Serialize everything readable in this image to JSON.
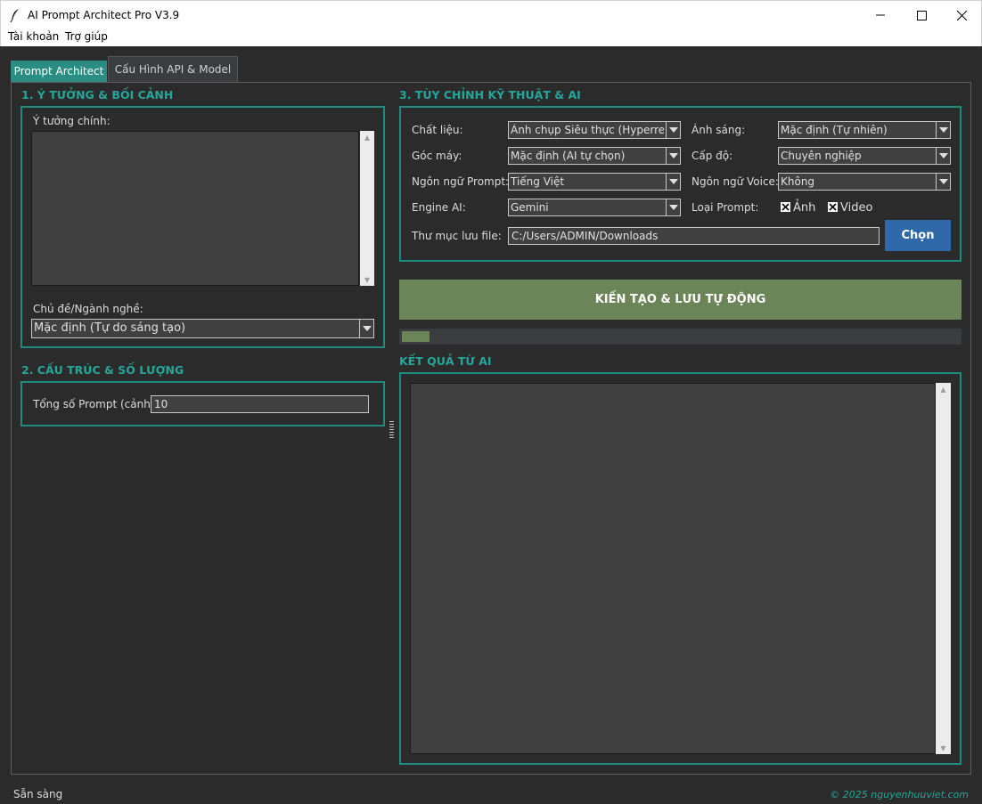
{
  "window": {
    "title": "AI Prompt Architect Pro V3.9",
    "controls": {
      "minimize": "minimize-icon",
      "maximize": "maximize-icon",
      "close": "close-icon"
    }
  },
  "menubar": {
    "items": [
      "Tài khoản",
      "Trợ giúp"
    ]
  },
  "tabs": [
    {
      "label": "Prompt Architect",
      "active": true
    },
    {
      "label": "Cấu Hình API & Model",
      "active": false
    }
  ],
  "section1": {
    "title": "1. Ý TƯỞNG & BỐI CẢNH",
    "idea_label": "Ý tưởng chính:",
    "idea_value": "",
    "topic_label": "Chủ đề/Ngành nghề:",
    "topic_value": "Mặc định (Tự do sáng tạo)"
  },
  "section2": {
    "title": "2. CẤU TRÚC & SỐ LƯỢNG",
    "total_label": "Tổng số Prompt (cảnh):",
    "total_value": "10"
  },
  "section3": {
    "title": "3. TÙY CHỈNH KỸ THUẬT & AI",
    "material_label": "Chất liệu:",
    "material_value": "Ảnh chụp Siêu thực (Hyperrealistic)",
    "lighting_label": "Ánh sáng:",
    "lighting_value": "Mặc định (Tự nhiên)",
    "camera_label": "Góc máy:",
    "camera_value": "Mặc định (AI tự chọn)",
    "level_label": "Cấp độ:",
    "level_value": "Chuyên nghiệp",
    "language_label": "Ngôn ngữ Prompt:",
    "language_value": "Tiếng Việt",
    "voice_label": "Ngôn ngữ Voice:",
    "voice_value": "Không",
    "engine_label": "Engine AI:",
    "engine_value": "Gemini",
    "type_label": "Loại Prompt:",
    "type_image": "Ảnh",
    "type_image_checked": true,
    "type_video": "Video",
    "type_video_checked": true,
    "folder_label": "Thư mục lưu file:",
    "folder_value": "C:/Users/ADMIN/Downloads",
    "choose_button": "Chọn"
  },
  "generate_button": "KIẾN TẠO & LƯU TỰ ĐỘNG",
  "progress": 0.05,
  "results": {
    "title": "KẾT QUẢ TỪ AI",
    "value": ""
  },
  "statusbar": {
    "status": "Sẵn sàng",
    "credit": "© 2025 nguyenhuuviet.com"
  },
  "colors": {
    "accent": "#26a69a",
    "frame": "#1f8a80",
    "tab_active": "#2a8d83",
    "choose_button": "#2e68a8",
    "generate_button": "#6b8458",
    "background": "#2b2b2b",
    "field": "#404040"
  }
}
